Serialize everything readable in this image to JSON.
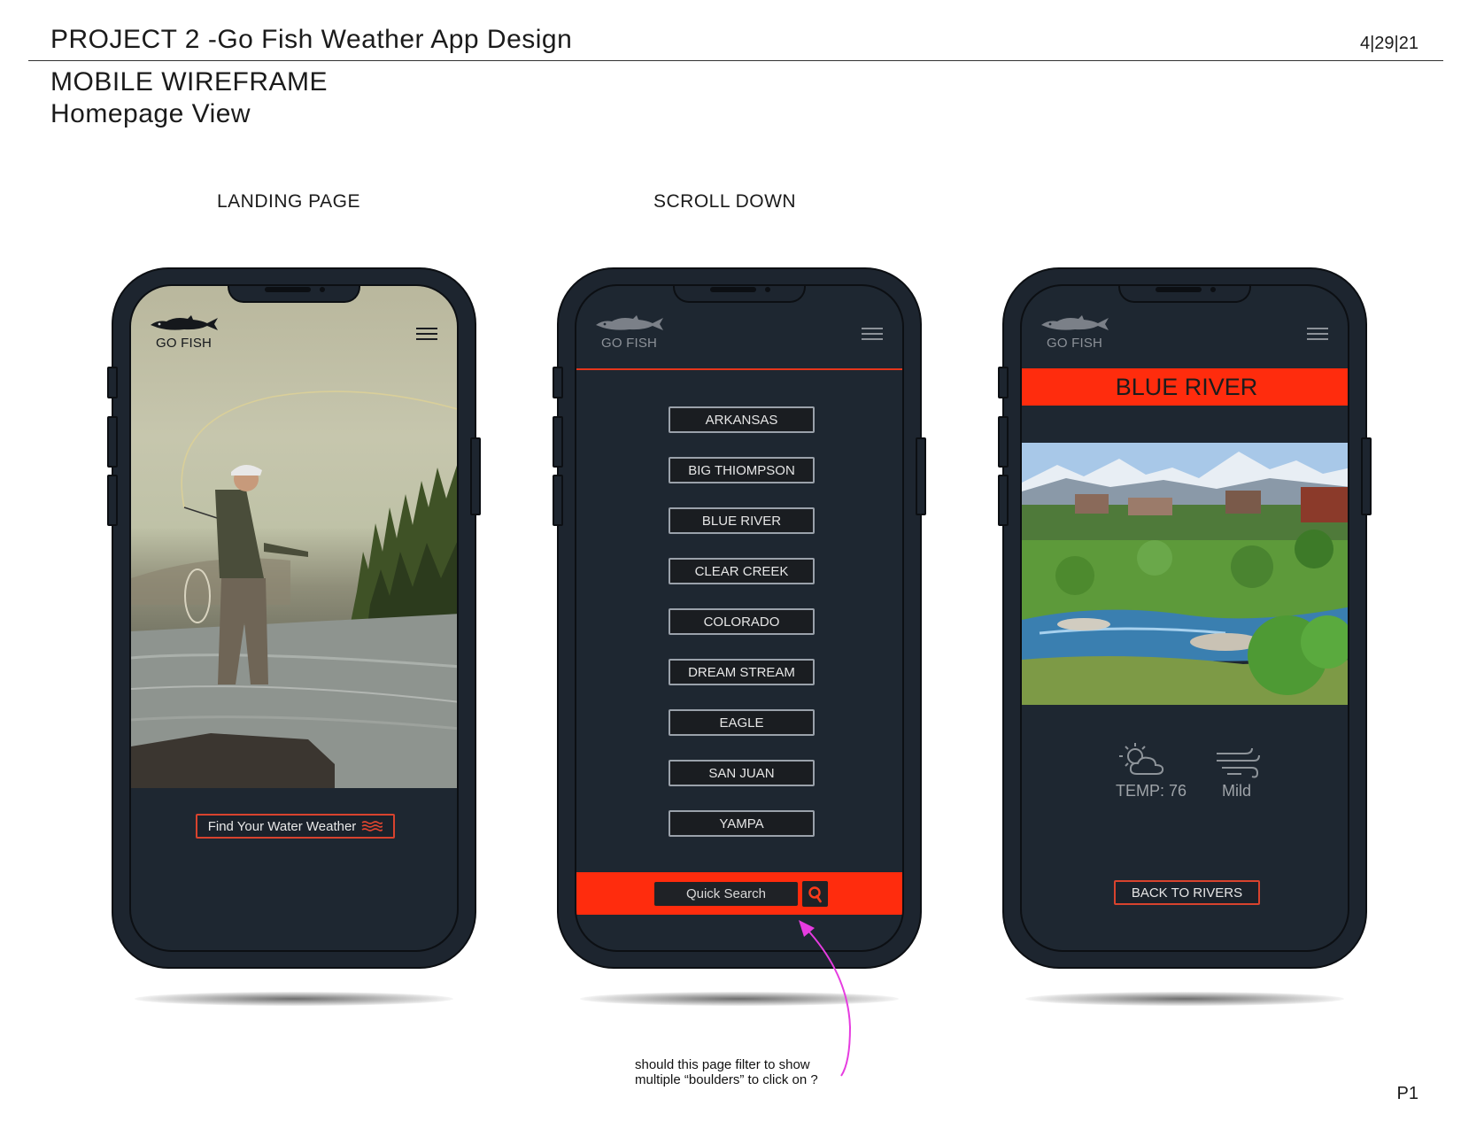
{
  "document": {
    "title": "PROJECT 2 -Go Fish Weather App Design",
    "date": "4|29|21",
    "subtitle_line1": "MOBILE WIREFRAME",
    "subtitle_line2": "Homepage View",
    "page_number": "P1"
  },
  "captions": {
    "landing": "LANDING PAGE",
    "scroll": "SCROLL DOWN"
  },
  "brand": {
    "logo_text": "GO FISH",
    "accent_color": "#ff2c0d",
    "screen_color": "#1e2731"
  },
  "landing": {
    "cta_label": "Find Your Water Weather"
  },
  "rivers": {
    "items": [
      "ARKANSAS",
      "BIG THIOMPSON",
      "BLUE RIVER",
      "CLEAR CREEK",
      "COLORADO",
      "DREAM STREAM",
      "EAGLE",
      "SAN JUAN",
      "YAMPA"
    ],
    "search_placeholder": "Quick Search"
  },
  "detail": {
    "title": "BLUE RIVER",
    "temp_label": "TEMP: 76",
    "wind_label": "Mild",
    "back_label": "BACK TO RIVERS"
  },
  "annotation": {
    "line1": "should this page filter to show",
    "line2": "multiple “boulders” to click on ?"
  },
  "icons": [
    "fish-logo-icon",
    "hamburger-menu-icon",
    "water-waves-icon",
    "search-icon",
    "partly-cloudy-icon",
    "wind-icon"
  ]
}
